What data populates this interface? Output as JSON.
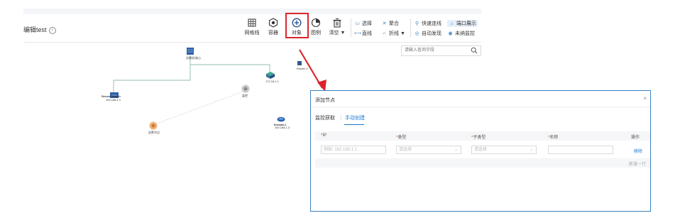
{
  "header": {
    "title": "编辑test"
  },
  "toolbar": {
    "grid_label": "网格线",
    "container_label": "容器",
    "object_label": "对象",
    "legend_label": "图例",
    "clear_label": "清空 ▼",
    "select_label": "选择",
    "aggregate_label": "聚合",
    "straight_label": "直线",
    "polyline_label": "折线 ▼",
    "quick_connect_label": "快速连线",
    "port_display_label": "端口展示",
    "auto_discover_label": "自动发现",
    "unmanaged_label": "未纳监控"
  },
  "search": {
    "placeholder": "请输入查询字段"
  },
  "topology": {
    "labels": {
      "switch_main": "交换机/核心",
      "router_right": "Router-1",
      "cloud_node": "172.16.1.1",
      "server_left": "Server-Switch",
      "server_left_ip": "192.168.1.1",
      "gray_node": "监控",
      "orange_node": "告警节点",
      "firewall_node": "firewall-1",
      "firewall_ip": "192.168.1.3",
      "small_right": "DB"
    }
  },
  "dialog": {
    "title": "添加节点",
    "close": "×",
    "tabs": [
      "监控获取",
      "手动创建"
    ],
    "columns": {
      "ip": "IP",
      "type": "类型",
      "subtype": "子类型",
      "name": "名称",
      "ops": "操作"
    },
    "row": {
      "ip_placeholder": "例如: 192.168.1.1",
      "type_placeholder": "请选择",
      "subtype_placeholder": "请选择",
      "name_value": "",
      "remove_label": "移除"
    },
    "add_row_label": "新增一行"
  },
  "colors": {
    "accent": "#1677d2",
    "highlight": "#d9262c",
    "arrow": "#d9262c"
  }
}
